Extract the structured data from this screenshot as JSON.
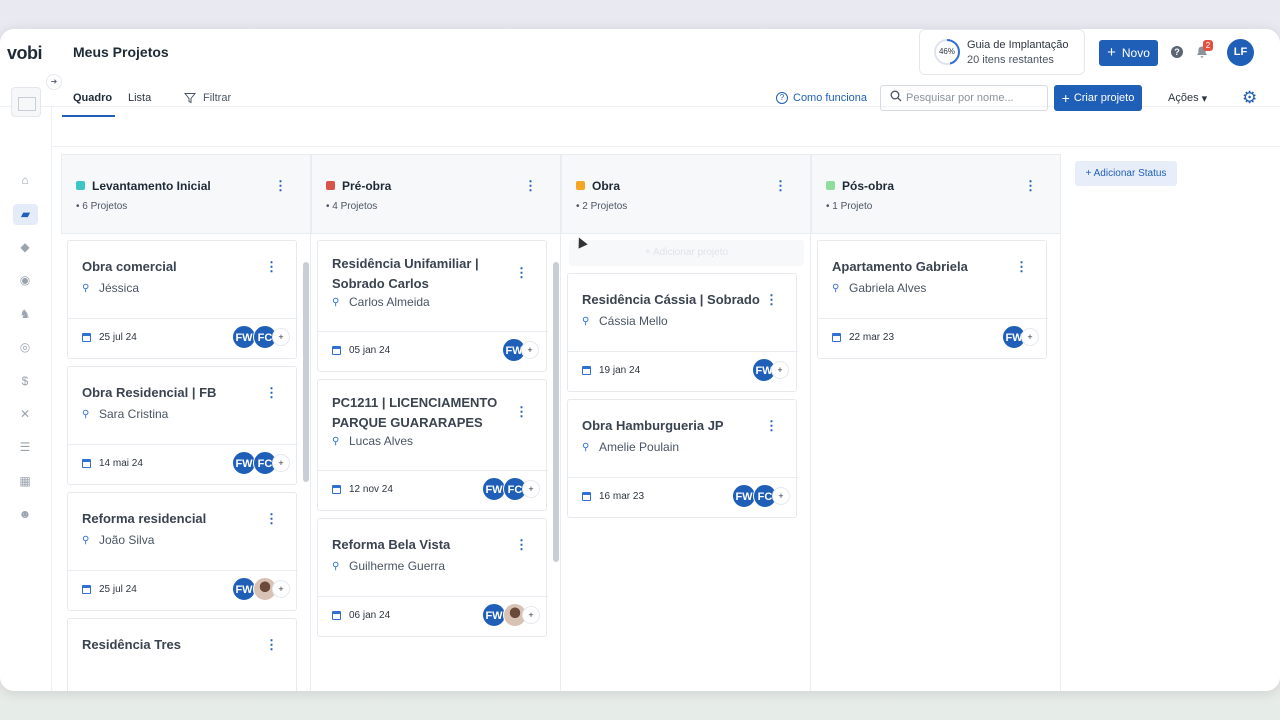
{
  "app": {
    "logo": "vobi",
    "page_title": "Meus Projetos"
  },
  "guide": {
    "percent": "46%",
    "title": "Guia de Implantação",
    "subtitle": "20 itens restantes"
  },
  "header": {
    "new_label": "Novo",
    "notification_count": "2",
    "user_initials": "LF"
  },
  "tabs": [
    {
      "label": "Quadro",
      "active": true
    },
    {
      "label": "Lista",
      "active": false
    }
  ],
  "toolbar": {
    "filter_label": "Filtrar",
    "how_it_works": "Como funciona",
    "search_placeholder": "Pesquisar por nome...",
    "create_label": "Criar projeto",
    "actions_label": "Ações"
  },
  "sidebar_icons": [
    "home-icon",
    "folder-icon",
    "handshake-icon",
    "compass-icon",
    "worker-icon",
    "coins-icon",
    "dollar-icon",
    "tools-icon",
    "list-icon",
    "apps-icon",
    "users-icon"
  ],
  "columns": [
    {
      "name": "Levantamento Inicial",
      "count": "• 6 Projetos",
      "color": "#3cc6c6",
      "cards": [
        {
          "title": "Obra comercial",
          "person": "Jéssica",
          "date": "25 jul 24",
          "avatars": [
            "FW",
            "FC"
          ]
        },
        {
          "title": "Obra Residencial | FB",
          "person": "Sara Cristina",
          "date": "14 mai 24",
          "avatars": [
            "FW",
            "FC"
          ]
        },
        {
          "title": "Reforma residencial",
          "person": "João Silva",
          "date": "25 jul 24",
          "avatars": [
            "FW",
            "photo"
          ]
        },
        {
          "title": "Residência Tres",
          "person": "",
          "date": "",
          "avatars": []
        }
      ]
    },
    {
      "name": "Pré-obra",
      "count": "• 4 Projetos",
      "color": "#d9534a",
      "cards": [
        {
          "title": "Residência Unifamiliar | Sobrado Carlos",
          "person": "Carlos Almeida",
          "date": "05 jan 24",
          "avatars": [
            "FW"
          ]
        },
        {
          "title": "PC1211 | LICENCIAMENTO PARQUE GUARARAPES",
          "person": "Lucas Alves",
          "date": "12 nov 24",
          "avatars": [
            "FW",
            "FC"
          ]
        },
        {
          "title": "Reforma Bela Vista",
          "person": "Guilherme Guerra",
          "date": "06 jan 24",
          "avatars": [
            "FW",
            "photo"
          ]
        }
      ]
    },
    {
      "name": "Obra",
      "count": "• 2 Projetos",
      "color": "#f5a623",
      "add_project_label": "+ Adicionar projeto",
      "cards": [
        {
          "title": "Residência Cássia | Sobrado",
          "person": "Cássia Mello",
          "date": "19 jan 24",
          "avatars": [
            "FW"
          ]
        },
        {
          "title": "Obra Hamburgueria JP",
          "person": "Amelie Poulain",
          "date": "16 mar 23",
          "avatars": [
            "FW",
            "FC"
          ]
        }
      ]
    },
    {
      "name": "Pós-obra",
      "count": "• 1 Projeto",
      "color": "#8fdc9c",
      "cards": [
        {
          "title": "Apartamento Gabriela",
          "person": "Gabriela Alves",
          "date": "22 mar 23",
          "avatars": [
            "FW"
          ]
        }
      ]
    }
  ],
  "add_status_label": "+ Adicionar Status",
  "avatar_plus": "+"
}
